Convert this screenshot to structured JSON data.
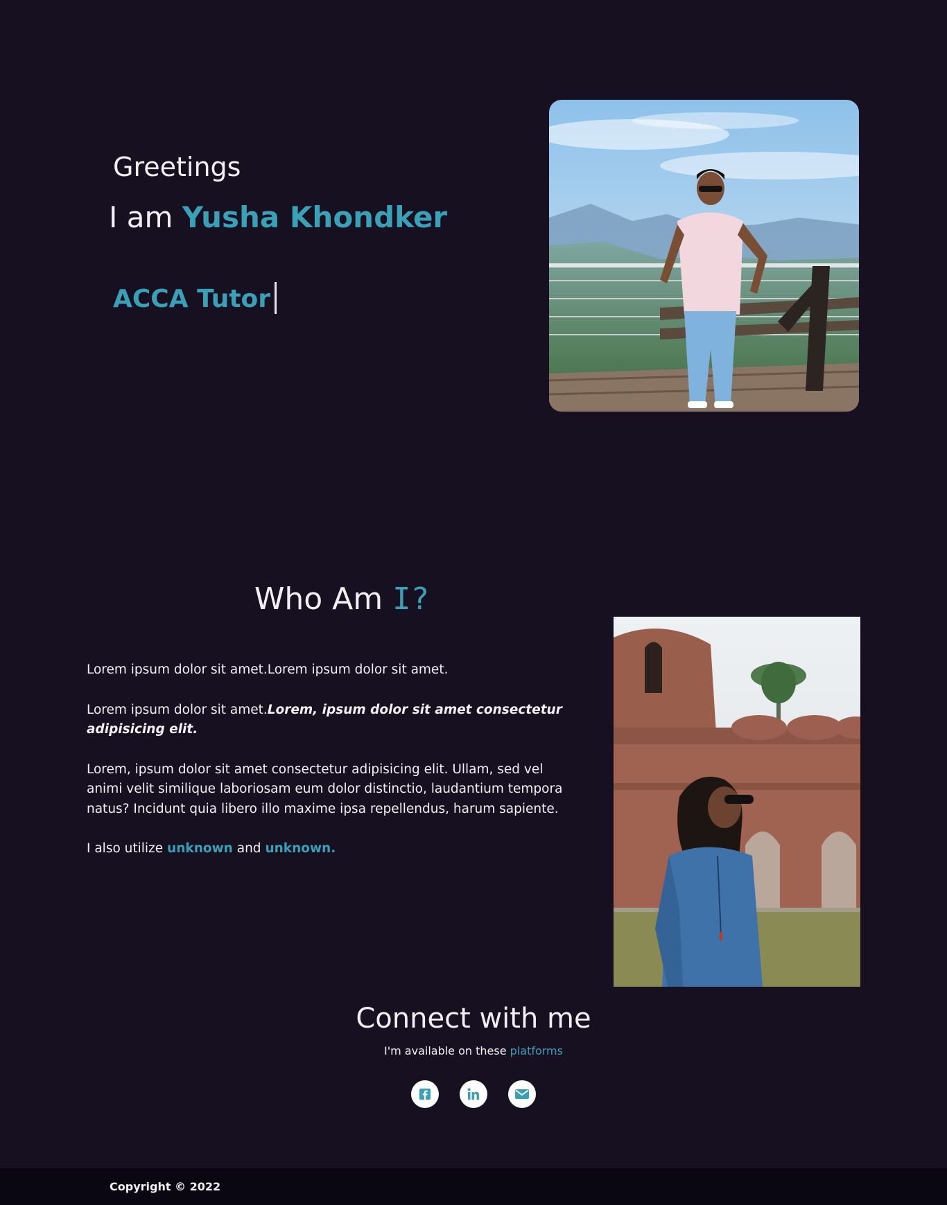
{
  "colors": {
    "background": "#161021",
    "accent": "#3aa0b5",
    "text": "#f2f0f5",
    "footer": "#0b0712"
  },
  "hero": {
    "greeting": "Greetings",
    "intro_prefix": "I am",
    "name": "Yusha Khondker",
    "role": "ACCA Tutor",
    "photo_alt": "Yusha Khondker standing on a viewing deck overlooking mountains"
  },
  "about": {
    "title_prefix": "Who Am",
    "title_accent": "I?",
    "para1": "Lorem ipsum dolor sit amet.Lorem ipsum dolor sit amet.",
    "para2_plain": "Lorem ipsum dolor sit amet.",
    "para2_emphasis": "Lorem, ipsum dolor sit amet consectetur adipisicing elit.",
    "para3": "Lorem, ipsum dolor sit amet consectetur adipisicing elit. Ullam, sed vel animi velit similique laboriosam eum dolor distinctio, laudantium tempora natus? Incidunt quia libero illo maxime ipsa repellendus, harum sapiente.",
    "para4_prefix": "I also utilize",
    "link1": "unknown",
    "para4_and": "and",
    "link2": "unknown.",
    "photo_alt": "Portrait in front of a brick mosque"
  },
  "connect": {
    "title": "Connect with me",
    "subtitle_prefix": "I'm available on these",
    "subtitle_accent": "platforms",
    "socials": [
      {
        "name": "facebook",
        "icon": "facebook-icon"
      },
      {
        "name": "linkedin",
        "icon": "linkedin-icon"
      },
      {
        "name": "email",
        "icon": "envelope-icon"
      }
    ]
  },
  "footer": {
    "copyright": "Copyright © 2022"
  }
}
